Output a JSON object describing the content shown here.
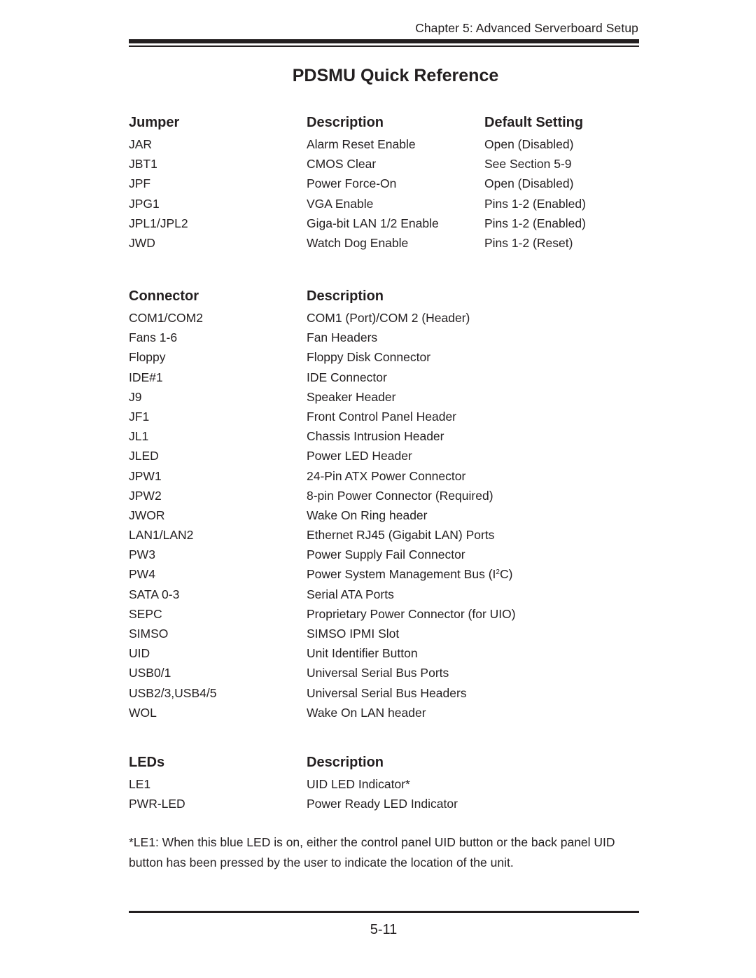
{
  "header": {
    "chapter": "Chapter 5: Advanced Serverboard Setup"
  },
  "title": "PDSMU Quick Reference",
  "jumpers": {
    "headers": [
      "Jumper",
      "Description",
      "Default Setting"
    ],
    "rows": [
      [
        "JAR",
        "Alarm Reset Enable",
        "Open (Disabled)"
      ],
      [
        "JBT1",
        "CMOS Clear",
        "See Section 5-9"
      ],
      [
        "JPF",
        "Power Force-On",
        "Open (Disabled)"
      ],
      [
        "JPG1",
        "VGA Enable",
        "Pins 1-2 (Enabled)"
      ],
      [
        "JPL1/JPL2",
        "Giga-bit LAN 1/2 Enable",
        "Pins 1-2 (Enabled)"
      ],
      [
        "JWD",
        "Watch Dog Enable",
        "Pins 1-2 (Reset)"
      ]
    ]
  },
  "connectors": {
    "headers": [
      "Connector",
      "Description"
    ],
    "rows": [
      [
        "COM1/COM2",
        "COM1 (Port)/COM 2 (Header)"
      ],
      [
        "Fans 1-6",
        "Fan Headers"
      ],
      [
        "Floppy",
        "Floppy Disk Connector"
      ],
      [
        "IDE#1",
        "IDE Connector"
      ],
      [
        "J9",
        "Speaker Header"
      ],
      [
        "JF1",
        "Front Control Panel Header"
      ],
      [
        "JL1",
        "Chassis Intrusion Header"
      ],
      [
        "JLED",
        "Power LED Header"
      ],
      [
        "JPW1",
        "24-Pin ATX Power Connector"
      ],
      [
        "JPW2",
        "8-pin Power Connector (Required)"
      ],
      [
        "JWOR",
        "Wake On Ring header"
      ],
      [
        "LAN1/LAN2",
        "Ethernet RJ45 (Gigabit LAN) Ports"
      ],
      [
        "PW3",
        "Power Supply Fail Connector"
      ],
      [
        "PW4",
        "Power System Management Bus (I",
        "2",
        "C)"
      ],
      [
        "SATA 0-3",
        "Serial ATA Ports"
      ],
      [
        "SEPC",
        "Proprietary Power Connector (for UIO)"
      ],
      [
        "SIMSO",
        "SIMSO IPMI Slot"
      ],
      [
        "UID",
        "Unit Identifier Button"
      ],
      [
        "USB0/1",
        "Universal Serial Bus Ports"
      ],
      [
        "USB2/3,USB4/5",
        "Universal Serial Bus Headers"
      ],
      [
        "WOL",
        "Wake On LAN header"
      ]
    ]
  },
  "leds": {
    "headers": [
      "LEDs",
      "Description"
    ],
    "rows": [
      [
        "LE1",
        "UID LED Indicator*"
      ],
      [
        "PWR-LED",
        "Power Ready LED Indicator"
      ]
    ]
  },
  "footnote": "*LE1: When this blue LED is on, either the control panel UID button or the back panel UID button has been pressed by the user to indicate the location of the unit.",
  "footer": {
    "page_number": "5-11"
  }
}
